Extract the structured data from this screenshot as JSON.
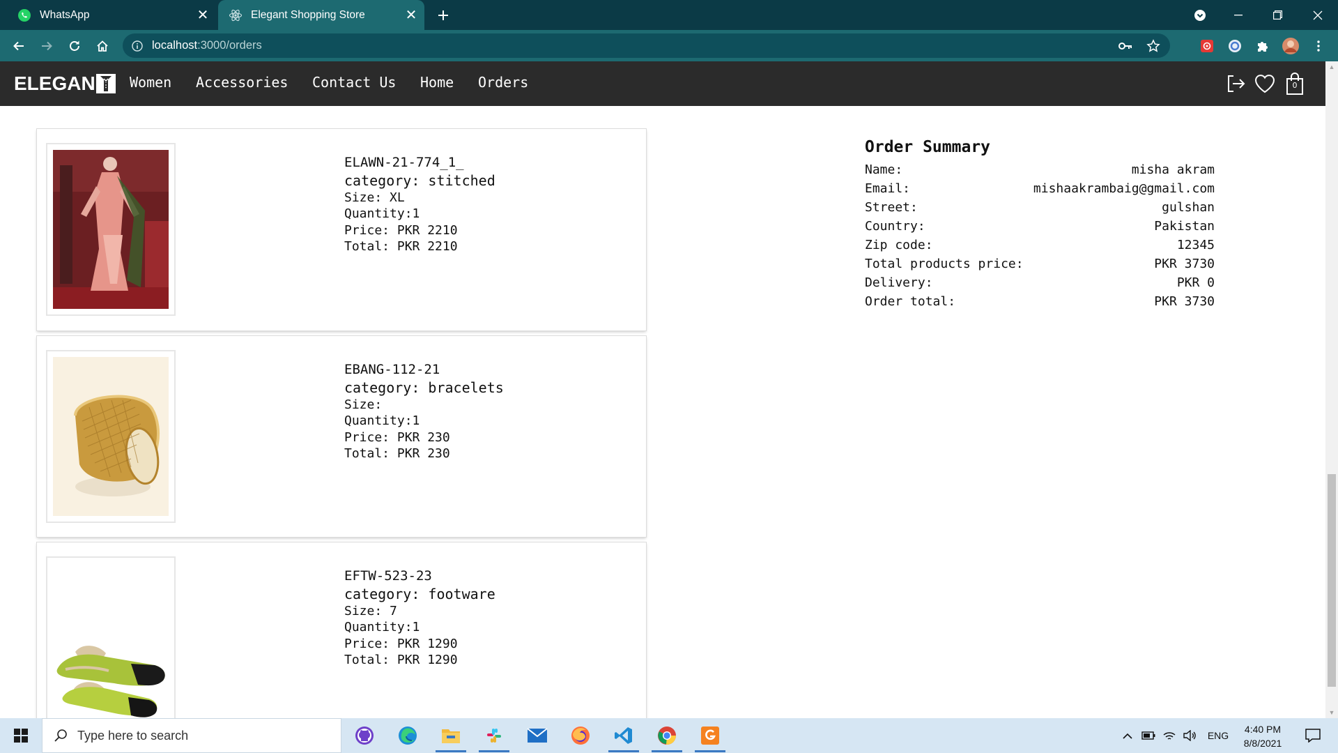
{
  "browser": {
    "tabs": [
      {
        "title": "WhatsApp",
        "icon": "whatsapp-icon",
        "active": false
      },
      {
        "title": "Elegant Shopping Store",
        "icon": "react-icon",
        "active": true
      }
    ],
    "url_host": "localhost",
    "url_path": ":3000/orders"
  },
  "site": {
    "logo": "ELEGAN",
    "nav": [
      "Women",
      "Accessories",
      "Contact Us",
      "Home",
      "Orders"
    ],
    "cart_count": "0"
  },
  "orders": [
    {
      "name": "ELAWN-21-774_1_",
      "category": "category: stitched",
      "size": "Size: XL",
      "quantity": "Quantity:1",
      "price": "Price: PKR 2210",
      "total": "Total: PKR 2210",
      "image": "stitched-dress-photo"
    },
    {
      "name": "EBANG-112-21",
      "category": "category: bracelets",
      "size": "Size:",
      "quantity": "Quantity:1",
      "price": "Price: PKR 230",
      "total": "Total: PKR 230",
      "image": "gold-bracelet-photo"
    },
    {
      "name": "EFTW-523-23",
      "category": "category: footware",
      "size": "Size: 7",
      "quantity": "Quantity:1",
      "price": "Price: PKR 1290",
      "total": "Total: PKR 1290",
      "image": "flat-shoe-photo"
    }
  ],
  "summary": {
    "title": "Order Summary",
    "rows": [
      {
        "label": "Name:",
        "value": "misha akram"
      },
      {
        "label": "Email:",
        "value": "mishaakrambaig@gmail.com"
      },
      {
        "label": "Street:",
        "value": "gulshan"
      },
      {
        "label": "Country:",
        "value": "Pakistan"
      },
      {
        "label": "Zip code:",
        "value": "12345"
      },
      {
        "label": "Total products price:",
        "value": "PKR 3730"
      },
      {
        "label": "Delivery:",
        "value": "PKR 0"
      },
      {
        "label": "Order total:",
        "value": "PKR 3730"
      }
    ]
  },
  "taskbar": {
    "search_placeholder": "Type here to search",
    "language": "ENG",
    "time": "4:40 PM",
    "date": "8/8/2021"
  },
  "colors": {
    "tab_strip": "#0b3a46",
    "toolbar": "#1d6a71",
    "site_header": "#2b2b2b"
  }
}
